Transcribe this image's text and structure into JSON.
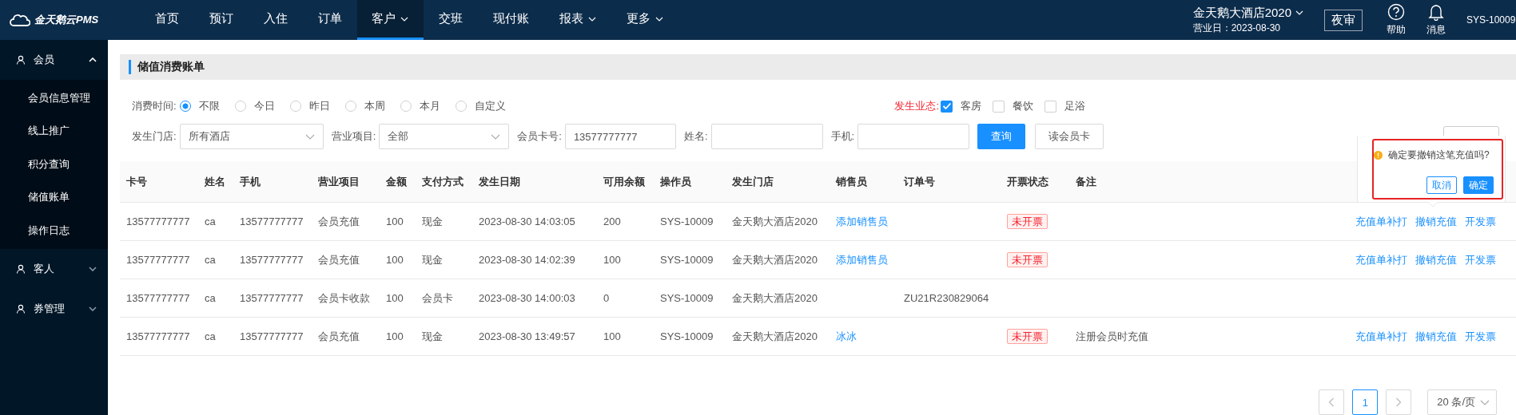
{
  "brand": "金天鹅云PMS",
  "nav": [
    {
      "label": "首页",
      "selected": false,
      "dropdown": false
    },
    {
      "label": "预订",
      "selected": false,
      "dropdown": false
    },
    {
      "label": "入住",
      "selected": false,
      "dropdown": false
    },
    {
      "label": "订单",
      "selected": false,
      "dropdown": false
    },
    {
      "label": "客户",
      "selected": true,
      "dropdown": true
    },
    {
      "label": "交班",
      "selected": false,
      "dropdown": false
    },
    {
      "label": "现付账",
      "selected": false,
      "dropdown": false
    },
    {
      "label": "报表",
      "selected": false,
      "dropdown": true
    },
    {
      "label": "更多",
      "selected": false,
      "dropdown": true
    }
  ],
  "hotel": {
    "name": "金天鹅大酒店2020",
    "business_date": "营业日：2023-08-30"
  },
  "night_audit_button": "夜审",
  "help": "帮助",
  "messages": "消息",
  "user": "SYS-10009",
  "sidebar": [
    {
      "label": "会员",
      "expanded": true,
      "children": [
        {
          "label": "会员信息管理"
        },
        {
          "label": "线上推广"
        },
        {
          "label": "积分查询"
        },
        {
          "label": "储值账单"
        },
        {
          "label": "操作日志"
        }
      ]
    },
    {
      "label": "客人",
      "expanded": false
    },
    {
      "label": "券管理",
      "expanded": false
    }
  ],
  "page_title": "储值消费账单",
  "time_filter": {
    "label": "消费时间:",
    "options": [
      {
        "label": "不限",
        "selected": true
      },
      {
        "label": "今日",
        "selected": false
      },
      {
        "label": "昨日",
        "selected": false
      },
      {
        "label": "本周",
        "selected": false
      },
      {
        "label": "本月",
        "selected": false
      },
      {
        "label": "自定义",
        "selected": false
      }
    ]
  },
  "business_filter": {
    "label": "发生业态:",
    "options": [
      {
        "label": "客房",
        "checked": true
      },
      {
        "label": "餐饮",
        "checked": false
      },
      {
        "label": "足浴",
        "checked": false
      }
    ]
  },
  "fields": [
    {
      "label": "发生门店:",
      "kind": "select",
      "value": "所有酒店"
    },
    {
      "label": "营业项目:",
      "kind": "select",
      "value": "全部"
    },
    {
      "label": "会员卡号:",
      "kind": "input",
      "value": "13577777777"
    },
    {
      "label": "姓名:",
      "kind": "input"
    },
    {
      "label": "手机:",
      "kind": "input"
    }
  ],
  "query_button": "查询",
  "read_card_button": "读会员卡",
  "table": {
    "columns": [
      "卡号",
      "姓名",
      "手机",
      "营业项目",
      "金额",
      "支付方式",
      "发生日期",
      "可用余额",
      "操作员",
      "发生门店",
      "销售员",
      "订单号",
      "开票状态",
      "备注"
    ],
    "rows": [
      {
        "cells": [
          {
            "kind": "text",
            "text": "13577777777"
          },
          {
            "kind": "text",
            "text": "ca"
          },
          {
            "kind": "text",
            "text": "13577777777"
          },
          {
            "kind": "text",
            "text": "会员充值"
          },
          {
            "kind": "text",
            "text": "100"
          },
          {
            "kind": "text",
            "text": "现金"
          },
          {
            "kind": "text",
            "text": "2023-08-30 14:03:05"
          },
          {
            "kind": "text",
            "text": "200"
          },
          {
            "kind": "text",
            "text": "SYS-10009"
          },
          {
            "kind": "text",
            "text": "金天鹅大酒店2020"
          },
          {
            "kind": "link",
            "text": "添加销售员"
          },
          {
            "kind": "empty"
          },
          {
            "kind": "tag",
            "text": "未开票"
          },
          {
            "kind": "empty"
          }
        ],
        "actions": [
          "充值单补打",
          "撤销充值",
          "开发票"
        ]
      },
      {
        "cells": [
          {
            "kind": "text",
            "text": "13577777777"
          },
          {
            "kind": "text",
            "text": "ca"
          },
          {
            "kind": "text",
            "text": "13577777777"
          },
          {
            "kind": "text",
            "text": "会员充值"
          },
          {
            "kind": "text",
            "text": "100"
          },
          {
            "kind": "text",
            "text": "现金"
          },
          {
            "kind": "text",
            "text": "2023-08-30 14:02:39"
          },
          {
            "kind": "text",
            "text": "100"
          },
          {
            "kind": "text",
            "text": "SYS-10009"
          },
          {
            "kind": "text",
            "text": "金天鹅大酒店2020"
          },
          {
            "kind": "link",
            "text": "添加销售员"
          },
          {
            "kind": "empty"
          },
          {
            "kind": "tag",
            "text": "未开票"
          },
          {
            "kind": "empty"
          }
        ],
        "actions": [
          "充值单补打",
          "撤销充值",
          "开发票"
        ]
      },
      {
        "cells": [
          {
            "kind": "text",
            "text": "13577777777"
          },
          {
            "kind": "text",
            "text": "ca"
          },
          {
            "kind": "text",
            "text": "13577777777"
          },
          {
            "kind": "text",
            "text": "会员卡收款"
          },
          {
            "kind": "text",
            "text": "100"
          },
          {
            "kind": "text",
            "text": "会员卡"
          },
          {
            "kind": "text",
            "text": "2023-08-30 14:00:03"
          },
          {
            "kind": "text",
            "text": "0"
          },
          {
            "kind": "text",
            "text": "SYS-10009"
          },
          {
            "kind": "text",
            "text": "金天鹅大酒店2020"
          },
          {
            "kind": "empty"
          },
          {
            "kind": "text",
            "text": "ZU21R230829064"
          },
          {
            "kind": "empty"
          },
          {
            "kind": "empty"
          }
        ]
      },
      {
        "cells": [
          {
            "kind": "text",
            "text": "13577777777"
          },
          {
            "kind": "text",
            "text": "ca"
          },
          {
            "kind": "text",
            "text": "13577777777"
          },
          {
            "kind": "text",
            "text": "会员充值"
          },
          {
            "kind": "text",
            "text": "100"
          },
          {
            "kind": "text",
            "text": "现金"
          },
          {
            "kind": "text",
            "text": "2023-08-30 13:49:57"
          },
          {
            "kind": "text",
            "text": "100"
          },
          {
            "kind": "text",
            "text": "SYS-10009"
          },
          {
            "kind": "text",
            "text": "金天鹅大酒店2020"
          },
          {
            "kind": "link",
            "text": "冰冰"
          },
          {
            "kind": "empty"
          },
          {
            "kind": "tag",
            "text": "未开票"
          },
          {
            "kind": "text",
            "text": "注册会员时充值"
          }
        ],
        "actions": [
          "充值单补打",
          "撤销充值",
          "开发票"
        ]
      }
    ]
  },
  "popconfirm": {
    "message": "确定要撤销这笔充值吗?",
    "cancel": "取消",
    "confirm": "确定"
  },
  "pagination": {
    "pages": [
      {
        "label": "1",
        "selected": true
      }
    ],
    "page_size": "20 条/页"
  }
}
